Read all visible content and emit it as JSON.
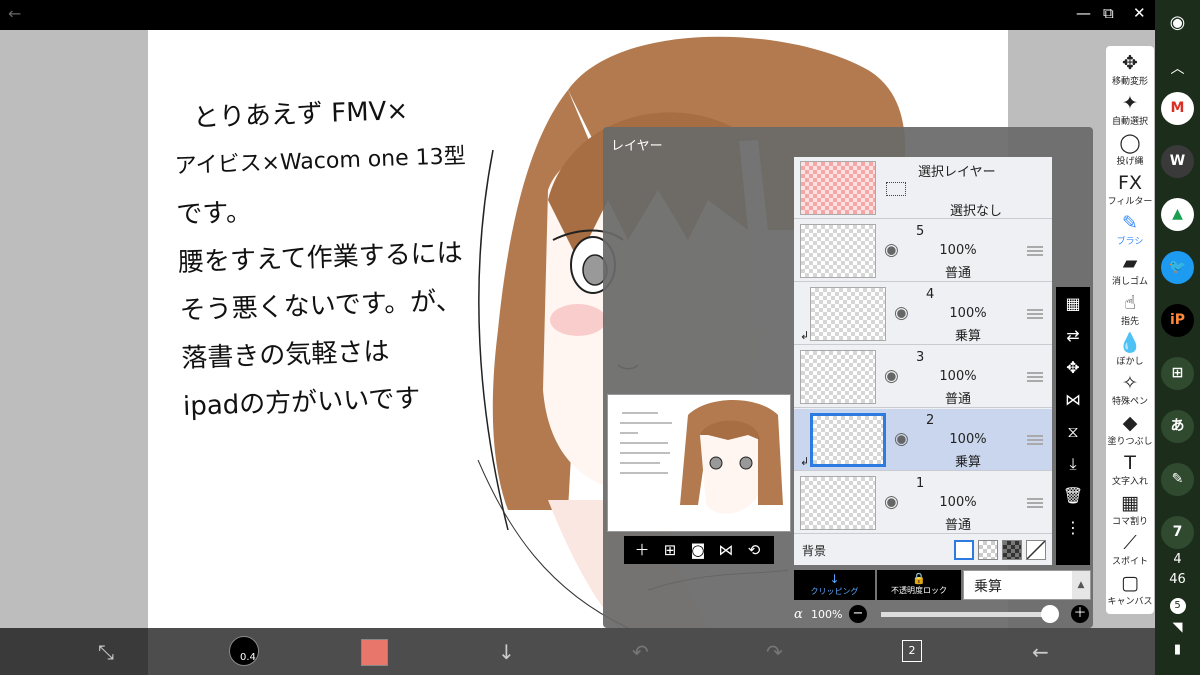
{
  "titlebar": {
    "back": "←",
    "minimize": "—",
    "restore": "⧉",
    "close": "✕"
  },
  "canvas_text": [
    "とりあえず FMV×",
    "アイビス×Wacom one 13型",
    "です。",
    "腰をすえて作業するには",
    "そう悪くないです。が、",
    "落書きの気軽さは",
    "ipadの方がいいです"
  ],
  "tools": [
    {
      "icon": "✥",
      "label": "移動変形",
      "name": "move-transform-tool"
    },
    {
      "icon": "✦",
      "label": "自動選択",
      "name": "auto-select-tool"
    },
    {
      "icon": "◯",
      "label": "投げ縄",
      "name": "lasso-tool"
    },
    {
      "icon": "FX",
      "label": "フィルター",
      "name": "filter-tool"
    },
    {
      "icon": "✎",
      "label": "ブラシ",
      "name": "brush-tool"
    },
    {
      "icon": "▰",
      "label": "消しゴム",
      "name": "eraser-tool"
    },
    {
      "icon": "☝",
      "label": "指先",
      "name": "smudge-tool"
    },
    {
      "icon": "💧",
      "label": "ぼかし",
      "name": "blur-tool"
    },
    {
      "icon": "✧",
      "label": "特殊ペン",
      "name": "special-pen-tool"
    },
    {
      "icon": "◆",
      "label": "塗りつぶし",
      "name": "fill-tool"
    },
    {
      "icon": "T",
      "label": "文字入れ",
      "name": "text-tool"
    },
    {
      "icon": "▦",
      "label": "コマ割り",
      "name": "frame-divider-tool"
    },
    {
      "icon": "⟋",
      "label": "スポイト",
      "name": "eyedropper-tool"
    },
    {
      "icon": "▢",
      "label": "キャンバス",
      "name": "canvas-tool"
    }
  ],
  "sidebar": {
    "items": [
      {
        "text": "M",
        "color": "#ffffff",
        "fg": "#d93025",
        "name": "gmail-app-icon"
      },
      {
        "text": "W",
        "color": "#3a3a3a",
        "fg": "#ffffff",
        "name": "wordpress-app-icon"
      },
      {
        "text": "▲",
        "color": "#ffffff",
        "fg": "#1a9e4f",
        "name": "drive-app-icon"
      },
      {
        "text": "🐦",
        "color": "#1d9bf0",
        "fg": "#ffffff",
        "name": "twitter-app-icon"
      },
      {
        "text": "iP",
        "color": "#000000",
        "fg": "#ff8a3d",
        "name": "ibis-app-icon"
      },
      {
        "text": "⊞",
        "color": "#2f4a2f",
        "fg": "#ffffff",
        "name": "screenshot-app-icon"
      },
      {
        "text": "あ",
        "color": "#2f4a2f",
        "fg": "#ffffff",
        "name": "keyboard-app-icon"
      },
      {
        "text": "✎",
        "color": "#2f4a2f",
        "fg": "#ffffff",
        "name": "pen-app-icon"
      },
      {
        "text": "7",
        "color": "#2f4a2f",
        "fg": "#ffffff",
        "name": "calendar-app-icon"
      }
    ],
    "time_hour": "4",
    "time_min": "46",
    "notif_count": "5"
  },
  "layer_panel": {
    "title": "レイヤー",
    "selection_layer": {
      "title": "選択レイヤー",
      "status": "選択なし"
    },
    "layers": [
      {
        "num": "5",
        "opacity": "100%",
        "blend": "普通",
        "clip": false,
        "selected": false
      },
      {
        "num": "4",
        "opacity": "100%",
        "blend": "乗算",
        "clip": true,
        "selected": false
      },
      {
        "num": "3",
        "opacity": "100%",
        "blend": "普通",
        "clip": false,
        "selected": false
      },
      {
        "num": "2",
        "opacity": "100%",
        "blend": "乗算",
        "clip": true,
        "selected": true
      },
      {
        "num": "1",
        "opacity": "100%",
        "blend": "普通",
        "clip": false,
        "selected": false
      }
    ],
    "background_label": "背景",
    "clipping_label": "クリッピング",
    "lock_label": "不透明度ロック",
    "blend_mode": "乗算",
    "alpha_symbol": "α",
    "alpha_value": "100%",
    "alpha_fraction": 1.0
  },
  "bottombar": {
    "brush_size": "0.4",
    "color": "#e8766a",
    "layer_count": "2"
  },
  "colors": {
    "selected_layer": "#c9d6ee",
    "accent": "#2d7be0"
  }
}
